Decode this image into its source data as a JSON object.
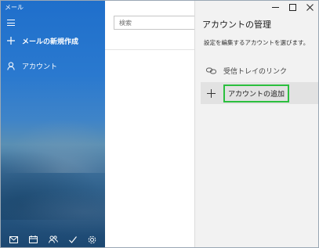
{
  "app": {
    "title": "メール"
  },
  "nav": {
    "new_mail_label": "メールの新規作成",
    "accounts_label": "アカウント",
    "bottom_icons": [
      "mail-icon",
      "calendar-icon",
      "people-icon",
      "todo-icon",
      "settings-icon"
    ]
  },
  "search": {
    "placeholder": "検索"
  },
  "flyout": {
    "title": "アカウントの管理",
    "subtitle": "設定を編集するアカウントを選びます。",
    "items": [
      {
        "label": "受信トレイのリンク",
        "icon": "link-icon"
      },
      {
        "label": "アカウントの追加",
        "icon": "plus-icon"
      }
    ]
  },
  "window_controls": [
    "minimize",
    "maximize",
    "close"
  ],
  "colors": {
    "nav_blue": "#1f6fcb",
    "highlight": "#2bbf3e",
    "flyout_bg": "#f2f2f2"
  }
}
